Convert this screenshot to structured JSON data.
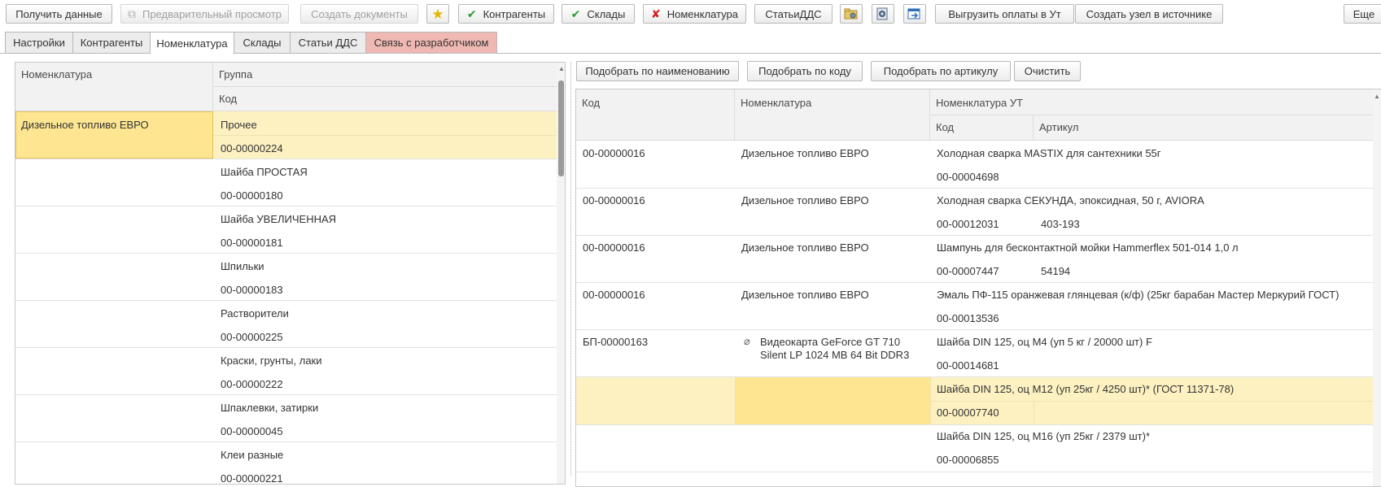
{
  "toolbar": {
    "get_data": "Получить данные",
    "preview": "Предварительный просмотр",
    "create_docs": "Создать документы",
    "contractors": "Контрагенты",
    "warehouses": "Склады",
    "nomenclature": "Номенклатура",
    "dds": "СтатьиДДС",
    "export_payments": "Выгрузить оплаты в Ут",
    "create_node": "Создать узел в источнике",
    "more": "Еще"
  },
  "tabs": [
    "Настройки",
    "Контрагенты",
    "Номенклатура",
    "Склады",
    "Статьи ДДС",
    "Связь с разработчиком"
  ],
  "left_table": {
    "headers": {
      "nomenclature": "Номенклатура",
      "group": "Группа",
      "code": "Код"
    },
    "selected_nomenclature": "Дизельное топливо ЕВРО",
    "rows": [
      {
        "group": "Прочее",
        "code": "00-00000224"
      },
      {
        "group": "Шайба ПРОСТАЯ",
        "code": "00-00000180"
      },
      {
        "group": "Шайба УВЕЛИЧЕННАЯ",
        "code": "00-00000181"
      },
      {
        "group": "Шпильки",
        "code": "00-00000183"
      },
      {
        "group": "Растворители",
        "code": "00-00000225"
      },
      {
        "group": "Краски, грунты, лаки",
        "code": "00-00000222"
      },
      {
        "group": "Шпаклевки, затирки",
        "code": "00-00000045"
      },
      {
        "group": "Клеи разные",
        "code": "00-00000221"
      }
    ]
  },
  "filter_buttons": {
    "by_name": "Подобрать по наименованию",
    "by_code": "Подобрать по коду",
    "by_article": "Подобрать по артикулу",
    "clear": "Очистить"
  },
  "right_table": {
    "headers": {
      "code": "Код",
      "nomenclature": "Номенклатура",
      "nomenclature_ut": "Номенклатура УТ",
      "ut_code": "Код",
      "ut_article": "Артикул"
    },
    "rows": [
      {
        "code": "00-00000016",
        "nomenclature": "Дизельное топливо ЕВРО",
        "ut_name": "Холодная сварка MASTIX для сантехники 55г",
        "ut_code": "00-00004698",
        "ut_article": ""
      },
      {
        "code": "00-00000016",
        "nomenclature": "Дизельное топливо ЕВРО",
        "ut_name": "Холодная сварка СЕКУНДА, эпоксидная, 50 г, AVIORA",
        "ut_code": "00-00012031",
        "ut_article": "403-193"
      },
      {
        "code": "00-00000016",
        "nomenclature": "Дизельное топливо ЕВРО",
        "ut_name": "Шампунь для бесконтактной мойки Hammerflex  501-014 1,0 л",
        "ut_code": "00-00007447",
        "ut_article": "54194"
      },
      {
        "code": "00-00000016",
        "nomenclature": "Дизельное топливо ЕВРО",
        "ut_name": "Эмаль ПФ-115 оранжевая глянцевая (к/ф) (25кг барабан Мастер Меркурий ГОСТ)",
        "ut_code": "00-00013536",
        "ut_article": ""
      },
      {
        "code": "БП-00000163",
        "nomenclature": "Видеокарта GeForce GT 710",
        "nomenclature2": "Silent LP 1024 MB 64 Bit DDR3",
        "ut_name": "Шайба DIN 125, оц  М4  (уп 5 кг / 20000 шт) F",
        "ut_code": "00-00014681",
        "ut_article": ""
      },
      {
        "code": "",
        "nomenclature": "",
        "ut_name": "Шайба DIN 125, оц М12  (уп 25кг / 4250 шт)*  (ГОСТ 11371-78)",
        "ut_code": "00-00007740",
        "ut_article": ""
      },
      {
        "code": "",
        "nomenclature": "",
        "ut_name": "Шайба DIN 125, оц М16  (уп 25кг / 2379 шт)*",
        "ut_code": "00-00006855",
        "ut_article": ""
      }
    ]
  }
}
